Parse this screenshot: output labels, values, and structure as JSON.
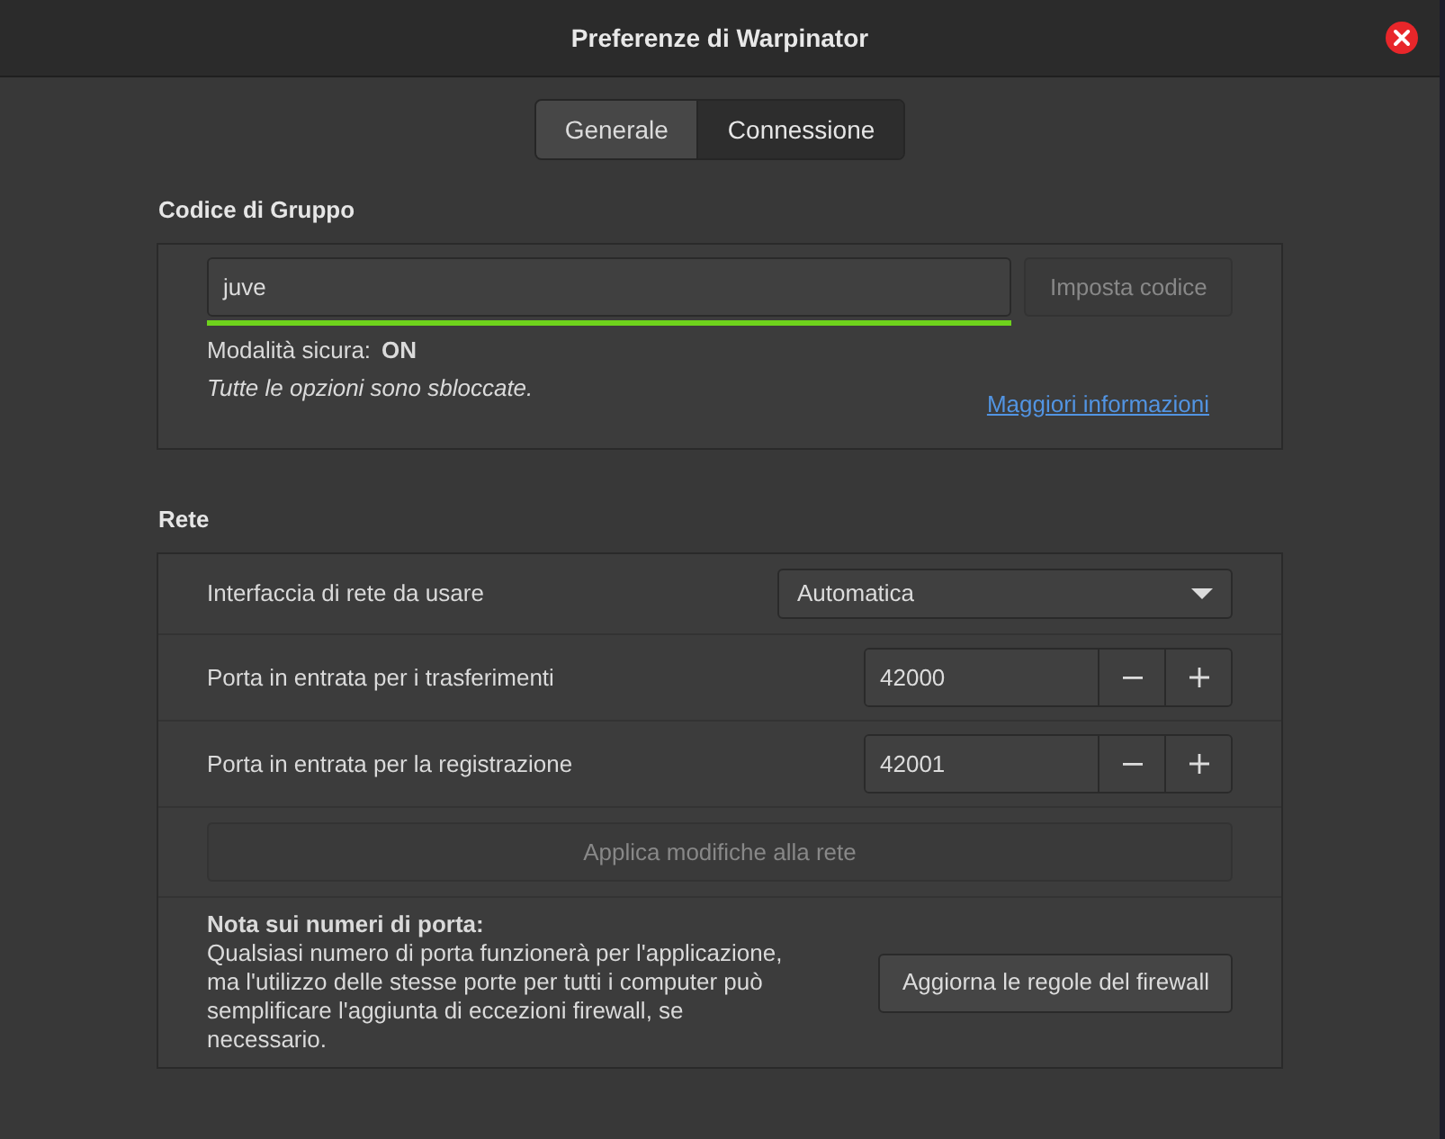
{
  "window": {
    "title": "Preferenze di Warpinator"
  },
  "tabs": [
    {
      "label": "Generale",
      "selected": false
    },
    {
      "label": "Connessione",
      "selected": true
    }
  ],
  "group_code": {
    "heading": "Codice di Gruppo",
    "code_field": {
      "value": "juve",
      "valid": true
    },
    "set_button": {
      "label": "Imposta codice",
      "disabled": true
    },
    "secure_mode": {
      "label": "Modalità sicura:",
      "value": "ON"
    },
    "status": "Tutte le opzioni sono sbloccate.",
    "more_info_link": "Maggiori informazioni"
  },
  "network": {
    "heading": "Rete",
    "rows": [
      {
        "kind": "combo",
        "label": "Interfaccia di rete da usare",
        "value": "Automatica"
      },
      {
        "kind": "spin",
        "label": "Porta in entrata per i trasferimenti",
        "value": "42000"
      },
      {
        "kind": "spin",
        "label": "Porta in entrata per la registrazione",
        "value": "42001"
      }
    ],
    "apply_button": {
      "label": "Applica modifiche alla rete",
      "disabled": true
    },
    "note": {
      "title": "Nota sui numeri di porta:",
      "text": "Qualsiasi numero di porta funzionerà per l'applicazione, ma l'utilizzo delle stesse porte per tutti i computer può semplificare l'aggiunta di eccezioni firewall, se necessario."
    },
    "firewall_button": {
      "label": "Aggiorna le regole del firewall"
    }
  }
}
